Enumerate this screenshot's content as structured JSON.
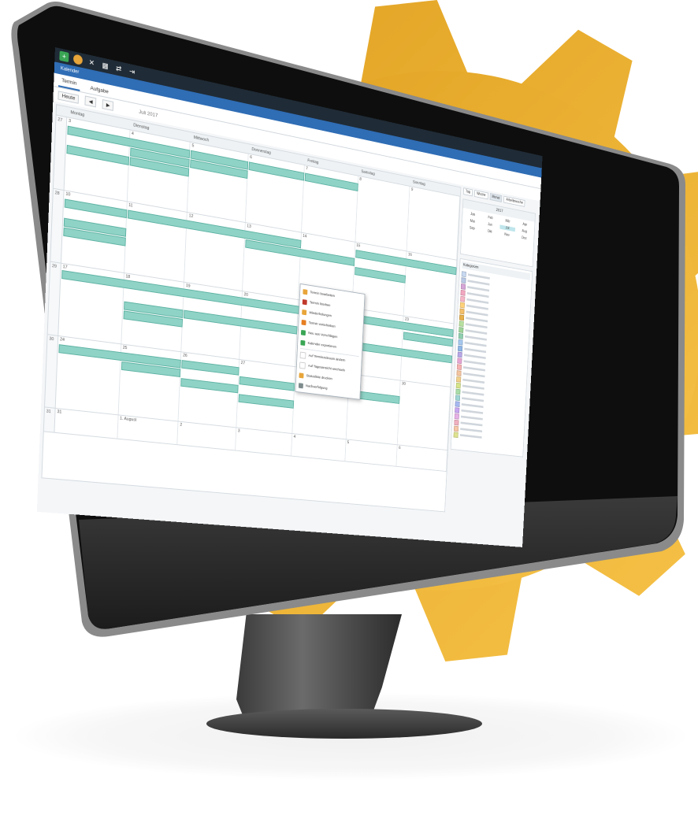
{
  "toolbar": {
    "icons": [
      "add-icon",
      "logo-icon",
      "tools-icon",
      "calendar-icon",
      "exchange-icon",
      "exit-icon"
    ]
  },
  "window": {
    "subtitle": "Kalender"
  },
  "tabs": [
    {
      "label": "Termin"
    },
    {
      "label": "Aufgabe"
    }
  ],
  "nav": {
    "today_label": "Heute",
    "month_label": "Juli 2017"
  },
  "calendar": {
    "weekdays": [
      "Montag",
      "Dienstag",
      "Mittwoch",
      "Donnerstag",
      "Freitag",
      "Samstag",
      "Sonntag"
    ],
    "weeks": [
      {
        "week": "27",
        "days": [
          "3",
          "4",
          "5",
          "6",
          "7",
          "8",
          "9"
        ]
      },
      {
        "week": "28",
        "days": [
          "10",
          "11",
          "12",
          "13",
          "14",
          "15",
          "16"
        ]
      },
      {
        "week": "29",
        "days": [
          "17",
          "18",
          "19",
          "20",
          "21",
          "22",
          "23"
        ]
      },
      {
        "week": "30",
        "days": [
          "24",
          "25",
          "26",
          "27",
          "28",
          "29",
          "30"
        ]
      },
      {
        "week": "31",
        "days": [
          "31",
          "1. August",
          "2",
          "3",
          "4",
          "5",
          "6"
        ]
      }
    ],
    "event_color": "#8fd3c6"
  },
  "view_buttons": [
    "Tag",
    "Woche",
    "Monat",
    "Arbeitswoche"
  ],
  "minical": {
    "title": "2017",
    "months": [
      "Jan",
      "Feb",
      "Mär",
      "Apr",
      "Mai",
      "Jun",
      "Jul",
      "Aug",
      "Sep",
      "Okt",
      "Nov",
      "Dez"
    ],
    "selected": "Jul"
  },
  "categories": {
    "title": "Kategorien",
    "colors": [
      "#c7d9f0",
      "#b9c9e6",
      "#d6a6d8",
      "#f2a7c0",
      "#f6b5c6",
      "#ffd27a",
      "#f4c06a",
      "#e7b04a",
      "#b8e0a0",
      "#9fd49a",
      "#8fcfb0",
      "#a6c8ef",
      "#8fb6e6",
      "#b7a6e6",
      "#e6a6d4",
      "#f7b2b2",
      "#f4c4a0",
      "#f2d08a",
      "#d6e48a",
      "#a8dca8",
      "#9fd6d6",
      "#a6b8f0",
      "#c8a6f0",
      "#e6b0e6",
      "#f0b0c0",
      "#f6c6a6",
      "#dfe38f"
    ]
  },
  "context_menu": {
    "items": [
      {
        "label": "Termin bearbeiten",
        "icon": "edit-icon",
        "color": "#e8a53a"
      },
      {
        "label": "Termin löschen",
        "icon": "delete-icon",
        "color": "#c0392b"
      },
      {
        "label": "Wiederholungen",
        "icon": "repeat-icon",
        "color": "#e8a53a"
      },
      {
        "label": "Termin verschieben",
        "icon": "move-icon",
        "color": "#e67e22"
      },
      {
        "label": "Neu aus Vorschlägen",
        "icon": "suggest-icon",
        "color": "#3aa655"
      },
      {
        "label": "Kalender exportieren",
        "icon": "export-icon",
        "color": "#3aa655"
      },
      {
        "label": "Auf Terminzeitraum ändern",
        "icon": "range-icon",
        "color": "#ffffff"
      },
      {
        "label": "Auf Tagesansicht wechseln",
        "icon": "day-icon",
        "color": "#ffffff"
      },
      {
        "label": "Statusliste drucken",
        "icon": "print-icon",
        "color": "#e8a53a"
      },
      {
        "label": "Nachverfolgung",
        "icon": "flag-icon",
        "color": "#7f8c8d"
      }
    ]
  },
  "colors": {
    "gear": "#f0b02e",
    "gear_light": "#f7c24a",
    "bezel": "#111111",
    "chin": "#2a2a2a"
  }
}
